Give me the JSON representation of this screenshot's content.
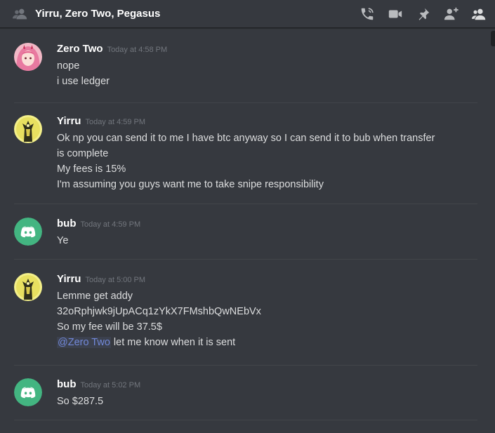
{
  "header": {
    "title": "Yirru, Zero Two, Pegasus",
    "icons": [
      "group-dm-icon",
      "call-icon",
      "video-icon",
      "pin-icon",
      "add-friend-icon",
      "member-list-icon"
    ]
  },
  "colors": {
    "background": "#36393f",
    "divider": "#42454a",
    "mention": "#7289da",
    "discord_green": "#43b581"
  },
  "messages": [
    {
      "author": "Zero Two",
      "timestamp": "Today at 4:58 PM",
      "avatar": "zero-two-avatar",
      "lines": [
        "nope",
        "i use ledger"
      ]
    },
    {
      "author": "Yirru",
      "timestamp": "Today at 4:59 PM",
      "avatar": "yirru-avatar",
      "lines": [
        "Ok np you can send it to me I have btc anyway so I can send it to bub when transfer is complete",
        "My fees is 15%",
        "I'm assuming you guys want me to take snipe responsibility"
      ]
    },
    {
      "author": "bub",
      "timestamp": "Today at 4:59 PM",
      "avatar": "discord-default-avatar",
      "lines": [
        "Ye"
      ]
    },
    {
      "author": "Yirru",
      "timestamp": "Today at 5:00 PM",
      "avatar": "yirru-avatar",
      "lines": [
        "Lemme get addy",
        "32oRphjwk9jUpACq1zYkX7FMshbQwNEbVx",
        "So my fee will be 37.5$"
      ],
      "mention": "@Zero Two",
      "mention_text": " let me know when it is sent"
    },
    {
      "author": "bub",
      "timestamp": "Today at 5:02 PM",
      "avatar": "discord-default-avatar",
      "lines": [
        "So $287.5"
      ]
    }
  ]
}
